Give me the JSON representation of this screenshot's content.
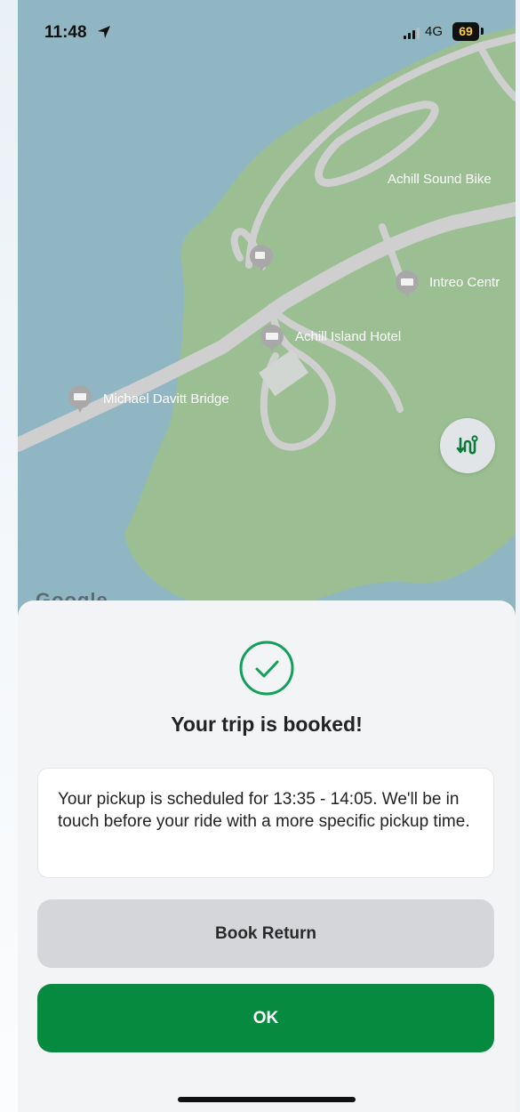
{
  "status_bar": {
    "time": "11:48",
    "network": "4G",
    "battery": "69"
  },
  "map": {
    "labels": {
      "bike": "Achill Sound Bike",
      "intreo": "Intreo Centr",
      "hotel": "Achill Island Hotel",
      "bridge": "Michael Davitt Bridge"
    },
    "attribution": "Google"
  },
  "sheet": {
    "title": "Your trip is booked!",
    "message": "Your pickup is scheduled for 13:35 - 14:05. We'll be in touch before your ride with a more specific pickup time.",
    "book_return_label": "Book Return",
    "ok_label": "OK"
  },
  "colors": {
    "water": "#91b6c3",
    "land": "#9bbf93",
    "accent_green": "#058a3f",
    "check_green": "#13a05a"
  }
}
